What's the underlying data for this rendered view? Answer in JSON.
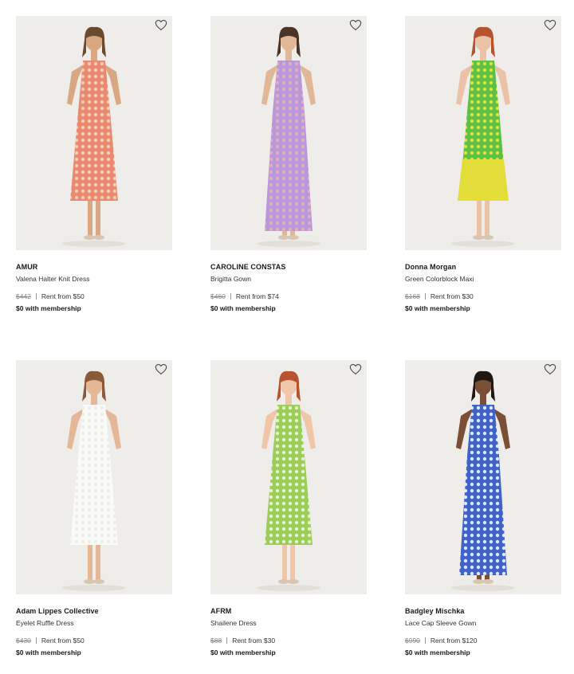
{
  "products": [
    {
      "brand": "AMUR",
      "name": "Valena Halter Knit Dress",
      "retail": "$442",
      "rent": "Rent from $50",
      "membership": "$0 with membership",
      "dress_colors": [
        "#e98a6f",
        "#f2c9b6"
      ],
      "hair": "#6b4a2e",
      "skin": "#d9a882"
    },
    {
      "brand": "CAROLINE CONSTAS",
      "name": "Brigitta Gown",
      "retail": "$460",
      "rent": "Rent from $74",
      "membership": "$0 with membership",
      "dress_colors": [
        "#b69ad8",
        "#e7a9c4"
      ],
      "hair": "#4a3526",
      "skin": "#e0b898"
    },
    {
      "brand": "Donna Morgan",
      "name": "Green Colorblock Maxi",
      "retail": "$168",
      "rent": "Rent from $30",
      "membership": "$0 with membership",
      "dress_colors": [
        "#5cc245",
        "#e3dd3a"
      ],
      "hair": "#b5542e",
      "skin": "#ecc2a6"
    },
    {
      "brand": "Adam Lippes Collective",
      "name": "Eyelet Ruffle Dress",
      "retail": "$430",
      "rent": "Rent from $50",
      "membership": "$0 with membership",
      "dress_colors": [
        "#fafaf7",
        "#eeeeea"
      ],
      "hair": "#8a5a3a",
      "skin": "#e4b896"
    },
    {
      "brand": "AFRM",
      "name": "Shailene Dress",
      "retail": "$88",
      "rent": "Rent from $30",
      "membership": "$0 with membership",
      "dress_colors": [
        "#9acd5a",
        "#e9f0c8"
      ],
      "hair": "#b5542e",
      "skin": "#f0c6a8"
    },
    {
      "brand": "Badgley Mischka",
      "name": "Lace Cap Sleeve Gown",
      "retail": "$990",
      "rent": "Rent from $120",
      "membership": "$0 with membership",
      "dress_colors": [
        "#3f63c8",
        "#dfe7f7"
      ],
      "hair": "#1f1712",
      "skin": "#7a4f35"
    }
  ]
}
